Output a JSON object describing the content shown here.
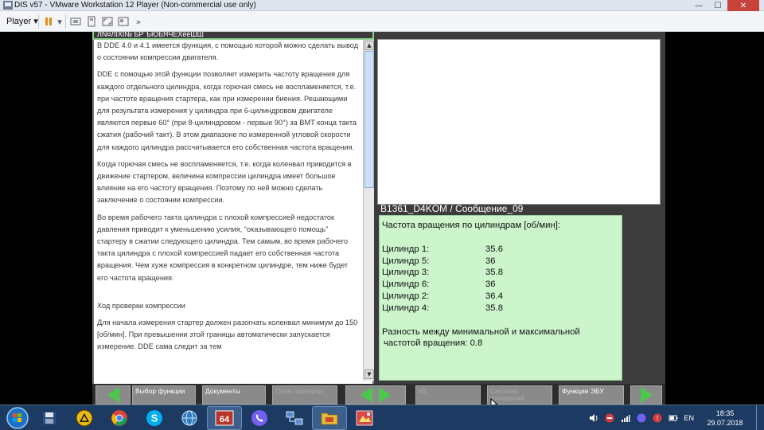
{
  "window": {
    "title": "DIS v57 - VMware Workstation 12 Player (Non-commercial use only)",
    "minimize_glyph": "—",
    "maximize_glyph": "☐",
    "close_glyph": "✕"
  },
  "vm_toolbar": {
    "player_label": "Player",
    "dropdown_glyph": "▾",
    "extra_glyph": "»"
  },
  "dis": {
    "doc_header": "ЛN¤ЛЇХI№ БР ЪЮБЯЧЕХёёШШ",
    "doc_paragraphs": [
      "В DDE 4.0 и 4.1 имеется функция, с помощью которой можно сделать вывод о состоянии компрессии двигателя.",
      "DDE с помощью этой функции позволяет измерить частоту вращения для каждого отдельного цилиндра, когда горючая смесь не воспламеняется, т.е. при частоте вращения стартера, как при измерении биения. Решающими для результата измерения у цилиндра при 6-цилиндровом двигателе являются первые 60° (при 8-цилиндровом - первые 90°) за ВМТ конца такта сжатия (рабочий такт). В этом диапазоне по измеренной угловой скорости для каждого цилиндра рассчитывается его собственная частота вращения.",
      "Когда горючая смесь не воспламеняется, т.е. когда коленвал приводится в движение стартером, величина компрессии цилиндра имеет большое влияние на его частоту вращения. Поэтому по ней можно сделать заключение о состоянии компрессии.",
      "Во время рабочего такта цилиндра с плохой компрессией недостаток давления приводит к уменьшению усилия, \"оказывающего помощь\" стартеру в сжатии следующего цилиндра. Тем самым, во время рабочего такта цилиндра с плохой компрессией падает  его собственная частота вращения. Чем хуже компрессия в конкретном цилиндре, тем ниже будет его частота вращения.",
      "",
      "Ход проверки компрессии",
      "Для начала измерения стартер должен разогнать коленвал минимум до 150 [об/мин]. При превышении этой границы автоматически запускается измерение. DDE сама следит за тем"
    ],
    "scroll_up_glyph": "▲",
    "scroll_down_glyph": "▼",
    "message_header": "B1361_D4KOM / Сообщение_09",
    "message_title": "Частота вращения по цилиндрам [об/мин]:",
    "cylinders": [
      {
        "label": "Цилиндр 1:",
        "value": "35.6"
      },
      {
        "label": "Цилиндр 5:",
        "value": "36"
      },
      {
        "label": "Цилиндр 3:",
        "value": "35.8"
      },
      {
        "label": "Цилиндр 6:",
        "value": "36"
      },
      {
        "label": "Цилиндр 2:",
        "value": "36.4"
      },
      {
        "label": "Цилиндр 4:",
        "value": "35.8"
      }
    ],
    "message_diff_line1": "Разность между минимальной и максимальной",
    "message_diff_line2": "частотой вращения:   0.8",
    "buttons": {
      "select_function": "Выбор функции",
      "documents": "Документы",
      "test_plan": "План проверки",
      "hash": "#3",
      "measurement_system": "Система измерений",
      "ecu_functions": "Функции ЭБУ"
    }
  },
  "taskbar": {
    "language": "EN",
    "time": "18:35",
    "date": "29.07.2018",
    "vm_app_label": "64"
  },
  "colors": {
    "accent_green": "#4cc84c",
    "message_bg": "#ccf5cc",
    "dis_bg": "#3c3c3c",
    "taskbar_bg": "#1c3a62"
  }
}
